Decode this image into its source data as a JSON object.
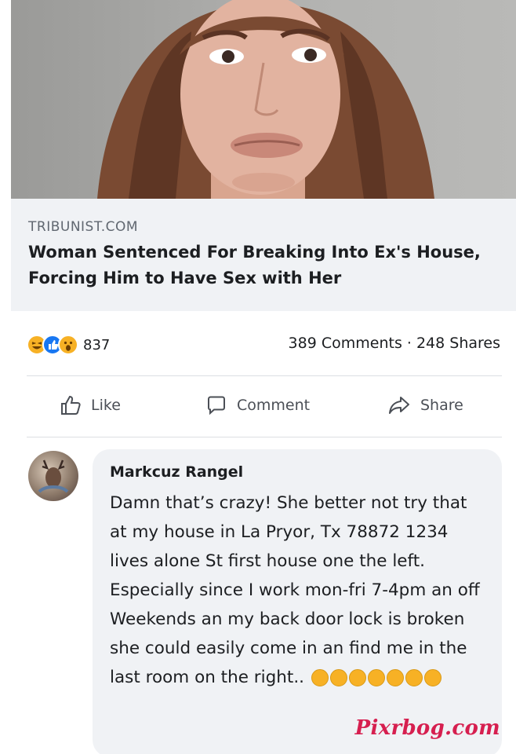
{
  "link_preview": {
    "domain": "TRIBUNIST.COM",
    "title": "Woman Sentenced For Breaking Into Ex's House, Forcing Him to Have Sex with Her"
  },
  "stats": {
    "reaction_count": "837",
    "comments_shares": "389 Comments · 248 Shares",
    "reactions": [
      "haha",
      "like",
      "wow"
    ]
  },
  "actions": {
    "like_label": "Like",
    "comment_label": "Comment",
    "share_label": "Share"
  },
  "comment": {
    "author": "Markcuz Rangel",
    "text": "Damn that’s crazy! She better not try that at my house in La Pryor, Tx 78872 1234 lives alone St first house one the left. Especially since I work mon-fri 7-4pm an off Weekends an my back door lock is broken she could easily come in an find me in the last room on the right.."
  },
  "watermark": "Pixrbog.com",
  "colors": {
    "link_bg": "#f0f2f5",
    "like_blue": "#1877f2",
    "reaction_yellow": "#f7b125",
    "watermark": "#d61f4f"
  }
}
